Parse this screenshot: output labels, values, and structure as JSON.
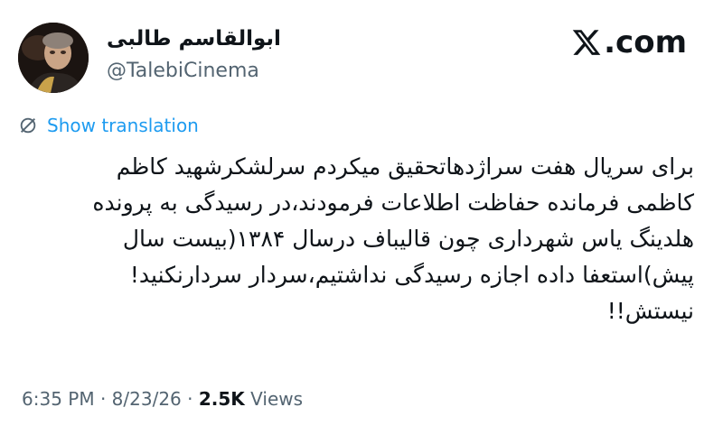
{
  "author": {
    "display_name": "ابوالقاسم طالبی",
    "handle": "@TalebiCinema"
  },
  "site": {
    "domain_label": ".com"
  },
  "translation": {
    "label": "Show translation"
  },
  "tweet": {
    "text": "برای سریال هفت سراژدهاتحقیق میکردم سرلشکرشهید کاظم\nکاظمی فرمانده حفاظت اطلاعات فرمودند،در رسیدگی به پرونده\nهلدینگ یاس شهرداری چون قالیباف درسال ۱۳۸۴(بیست سال\nپیش)استعفا داده اجازه رسیدگی نداشتیم،سردار سردارنکنید!\nنیستش!!"
  },
  "meta": {
    "time": "6:35 PM",
    "separator": " · ",
    "date": "8/23/26",
    "views_count": "2.5K",
    "views_label": " Views"
  },
  "icons": {
    "logo": "x-logo-icon",
    "translate": "globe-strike-icon"
  },
  "colors": {
    "link": "#1d9bf0",
    "secondary_text": "#536471",
    "primary_text": "#0f1419",
    "background": "#ffffff"
  }
}
